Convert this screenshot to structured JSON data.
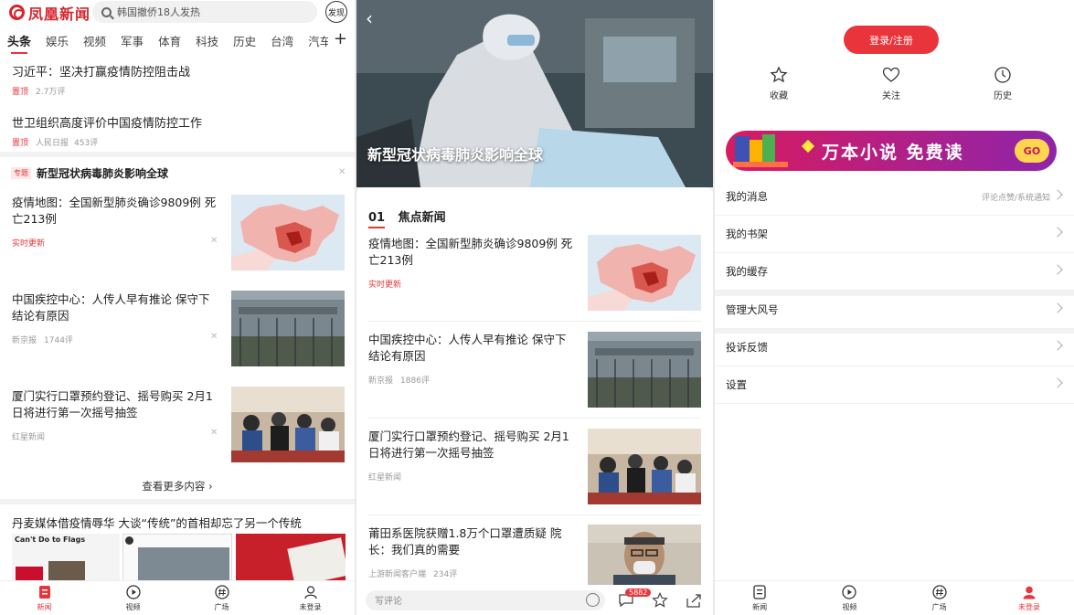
{
  "panel1": {
    "logo": "凤凰新闻",
    "search_placeholder": "韩国撤侨18人发热",
    "publish": "发现",
    "channels": [
      "头条",
      "娱乐",
      "视频",
      "军事",
      "体育",
      "科技",
      "历史",
      "台湾",
      "汽车"
    ],
    "top_items": [
      {
        "title": "习近平：坚决打赢疫情防控阻击战",
        "tag": "置顶",
        "meta": [
          "2.7万评"
        ]
      },
      {
        "title": "世卫组织高度评价中国疫情防控工作",
        "tag": "置顶",
        "meta": [
          "人民日报",
          "453评"
        ]
      }
    ],
    "topic_tag": "专题",
    "topic_title": "新型冠状病毒肺炎影响全球",
    "news": [
      {
        "title": "疫情地图：全国新型肺炎确诊9809例 死亡213例",
        "meta_red": "实时更新",
        "meta": []
      },
      {
        "title": "中国疾控中心：人传人早有推论 保守下结论有原因",
        "meta": [
          "新京报",
          "1744评"
        ]
      },
      {
        "title": "厦门实行口罩预约登记、摇号购买 2月1日将进行第一次摇号抽签",
        "meta": [
          "红星新闻"
        ]
      }
    ],
    "more": "查看更多内容",
    "bottom_title": "丹麦媒体借疫情辱华 大谈“传统”的首相却忘了另一个传统",
    "strip_caption": "Can't Do to Flags",
    "tabs": [
      "新闻",
      "视频",
      "广场",
      "未登录"
    ]
  },
  "panel2": {
    "hero_title": "新型冠状病毒肺炎影响全球",
    "section_num": "01",
    "section_title": "焦点新闻",
    "news": [
      {
        "title": "疫情地图：全国新型肺炎确诊9809例 死亡213例",
        "meta_red": "实时更新",
        "meta": []
      },
      {
        "title": "中国疾控中心：人传人早有推论 保守下结论有原因",
        "meta": [
          "新京报",
          "1886评"
        ]
      },
      {
        "title": "厦门实行口罩预约登记、摇号购买 2月1日将进行第一次摇号抽签",
        "meta": [
          "红星新闻"
        ]
      },
      {
        "title": "莆田系医院获赠1.8万个口罩遭质疑 院长：我们真的需要",
        "meta": [
          "上游新闻客户端",
          "234评"
        ]
      }
    ],
    "comment_placeholder": "写评论",
    "comment_count": "5882"
  },
  "panel3": {
    "login": "登录/注册",
    "quick": [
      "收藏",
      "关注",
      "历史"
    ],
    "banner_text": "万本小说 免费读",
    "banner_go": "GO",
    "menu": [
      {
        "label": "我的消息",
        "right": "评论点赞/系统通知"
      },
      {
        "label": "我的书架",
        "right": ""
      },
      {
        "label": "我的缓存",
        "right": ""
      },
      {
        "label": "管理大风号",
        "right": ""
      },
      {
        "label": "投诉反馈",
        "right": ""
      },
      {
        "label": "设置",
        "right": ""
      }
    ],
    "tabs": [
      "新闻",
      "视频",
      "广场",
      "未登录"
    ]
  },
  "colors": {
    "accent": "#e8343a",
    "banner": "#c2185b"
  }
}
